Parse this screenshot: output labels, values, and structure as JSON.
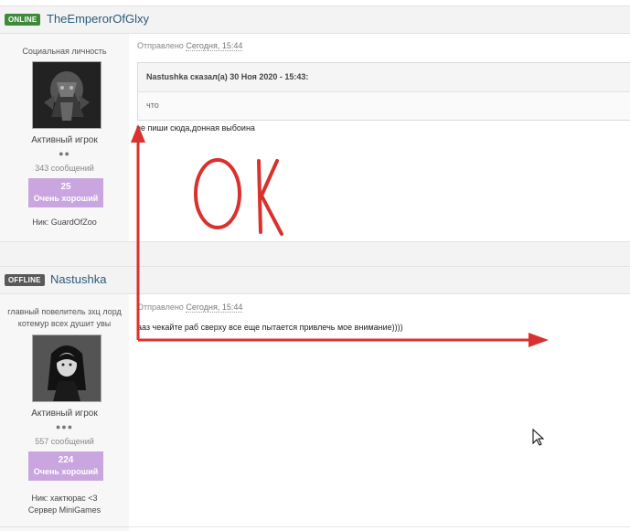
{
  "posts": [
    {
      "status": "ONLINE",
      "username": "TheEmperorOfGlxy",
      "user_title": "Социальная личность",
      "rank": "Активный игрок",
      "dots": "●●",
      "messages": "343 сообщений",
      "reputation": {
        "value": "25",
        "label": "Очень хороший"
      },
      "nick": "Ник: GuardOfZoo",
      "meta_prefix": "Отправлено",
      "meta_time": "Сегодня, 15:44",
      "quote": {
        "header": "Nastushka сказал(а) 30 Ноя 2020 - 15:43:",
        "text": "что"
      },
      "text": "не пиши сюда,донная выбоина",
      "avatar_icon": "robot-warrior-avatar"
    },
    {
      "status": "OFFLINE",
      "username": "Nastushka",
      "user_title_line1": "главный повелитель зхц лорд",
      "user_title_line2": "котемур всех душит увы",
      "rank": "Активный игрок",
      "dots": "●●●",
      "messages": "557 сообщений",
      "reputation": {
        "value": "224",
        "label": "Очень хороший"
      },
      "nick_line1": "Ник: хактюрас <3",
      "nick_line2": "Сервер MiniGames",
      "meta_prefix": "Отправлено",
      "meta_time": "Сегодня, 15:44",
      "text": "ааз чекайте раб сверху все еще пытается привлечь мое внимание))))",
      "avatar_icon": "dark-girl-avatar"
    }
  ],
  "annotation": {
    "text": "OK",
    "color": "#d9322e"
  }
}
